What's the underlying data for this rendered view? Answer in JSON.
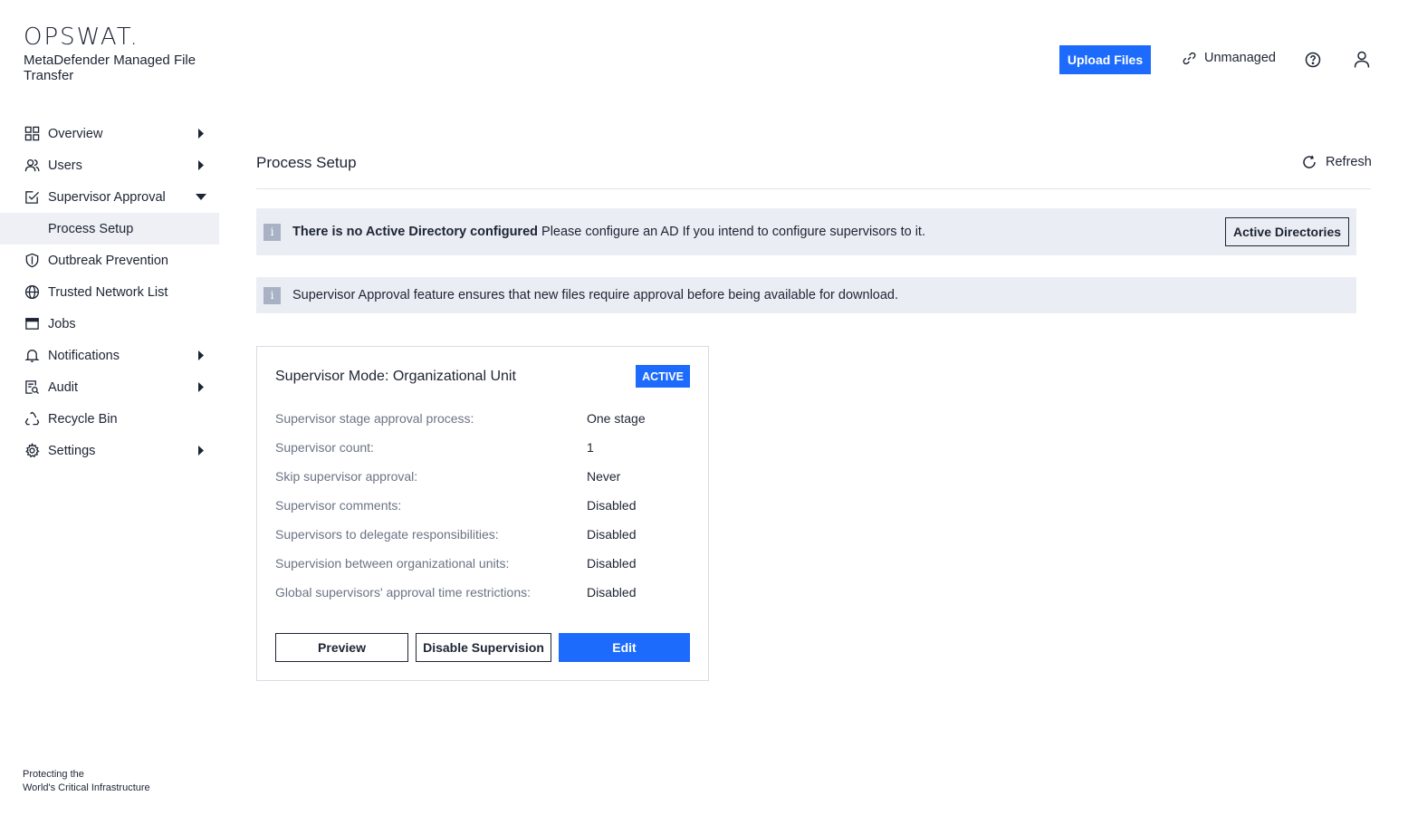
{
  "brand": {
    "logo": "OPSWAT.",
    "product": "MetaDefender Managed File Transfer"
  },
  "sidebar": {
    "items": [
      {
        "label": "Overview",
        "icon": "grid-icon",
        "expandable": true
      },
      {
        "label": "Users",
        "icon": "users-icon",
        "expandable": true
      },
      {
        "label": "Supervisor Approval",
        "icon": "checkbox-icon",
        "expanded": true
      },
      {
        "label": "Process Setup",
        "sub": true,
        "active": true
      },
      {
        "label": "Outbreak Prevention",
        "icon": "shield-icon"
      },
      {
        "label": "Trusted Network List",
        "icon": "globe-icon"
      },
      {
        "label": "Jobs",
        "icon": "window-icon"
      },
      {
        "label": "Notifications",
        "icon": "bell-icon",
        "expandable": true
      },
      {
        "label": "Audit",
        "icon": "audit-icon",
        "expandable": true
      },
      {
        "label": "Recycle Bin",
        "icon": "recycle-icon"
      },
      {
        "label": "Settings",
        "icon": "gear-icon",
        "expandable": true
      }
    ],
    "tagline_line1": "Protecting the",
    "tagline_line2": "World's Critical Infrastructure"
  },
  "header": {
    "upload_label": "Upload Files",
    "unmanaged_label": "Unmanaged"
  },
  "main": {
    "title": "Process Setup",
    "refresh_label": "Refresh",
    "alert_ad": {
      "bold": "There is no Active Directory configured",
      "text": " Please configure an AD If you intend to configure supervisors to it.",
      "button": "Active Directories"
    },
    "alert_info": {
      "text": "Supervisor Approval feature ensures that new files require approval before being available for download."
    },
    "card": {
      "title": "Supervisor Mode: Organizational Unit",
      "badge": "ACTIVE",
      "rows": [
        {
          "key": "Supervisor stage approval process:",
          "value": "One stage"
        },
        {
          "key": "Supervisor count:",
          "value": "1"
        },
        {
          "key": "Skip supervisor approval:",
          "value": "Never"
        },
        {
          "key": "Supervisor comments:",
          "value": "Disabled"
        },
        {
          "key": "Supervisors to delegate responsibilities:",
          "value": "Disabled"
        },
        {
          "key": "Supervision between organizational units:",
          "value": "Disabled"
        },
        {
          "key": "Global supervisors' approval time restrictions:",
          "value": "Disabled"
        }
      ],
      "preview_label": "Preview",
      "disable_label": "Disable Supervision",
      "edit_label": "Edit"
    }
  },
  "colors": {
    "accent": "#1d6bfc",
    "alert_bg": "#eaedf3",
    "active_nav_bg": "#eef0f5"
  }
}
